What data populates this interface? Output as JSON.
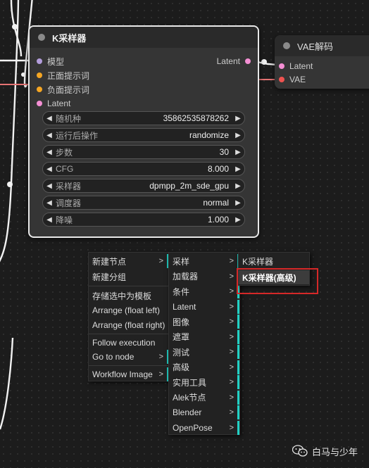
{
  "ksampler": {
    "title": "K采样器",
    "inputs": [
      {
        "label": "模型",
        "color": "#b39ddb"
      },
      {
        "label": "正面提示词",
        "color": "#f5a623"
      },
      {
        "label": "负面提示词",
        "color": "#f5a623"
      },
      {
        "label": "Latent",
        "color": "#f48fd4"
      }
    ],
    "output": {
      "label": "Latent",
      "color": "#f48fd4"
    },
    "widgets": [
      {
        "label": "随机种",
        "value": "35862535878262"
      },
      {
        "label": "运行后操作",
        "value": "randomize"
      },
      {
        "label": "步数",
        "value": "30"
      },
      {
        "label": "CFG",
        "value": "8.000"
      },
      {
        "label": "采样器",
        "value": "dpmpp_2m_sde_gpu"
      },
      {
        "label": "调度器",
        "value": "normal"
      },
      {
        "label": "降噪",
        "value": "1.000"
      }
    ]
  },
  "vae": {
    "title": "VAE解码",
    "inputs": [
      {
        "label": "Latent",
        "color": "#f48fd4"
      },
      {
        "label": "VAE",
        "color": "#ef5350"
      }
    ]
  },
  "menu1": {
    "items": [
      {
        "label": "新建节点",
        "submenu": true
      },
      {
        "label": "新建分组",
        "submenu": false
      },
      {
        "label": "存储选中为模板",
        "submenu": false
      },
      {
        "label": "Arrange (float left)",
        "submenu": false
      },
      {
        "label": "Arrange (float right)",
        "submenu": false
      },
      {
        "label": "Follow execution",
        "submenu": false
      },
      {
        "label": "Go to node",
        "submenu": true
      },
      {
        "label": "Workflow Image",
        "submenu": true
      }
    ]
  },
  "menu2": {
    "items": [
      "采样",
      "加载器",
      "条件",
      "Latent",
      "图像",
      "遮罩",
      "测试",
      "高级",
      "实用工具",
      "Alek节点",
      "Blender",
      "OpenPose"
    ]
  },
  "menu3": {
    "items": [
      "K采样器",
      "K采样器(高级)"
    ]
  },
  "watermark": {
    "text": "白马与少年"
  },
  "colors": {
    "accent": "#21d1c4",
    "highlight_box": "#d62828",
    "link": "#f2f2f2",
    "link_red": "#e57373"
  }
}
